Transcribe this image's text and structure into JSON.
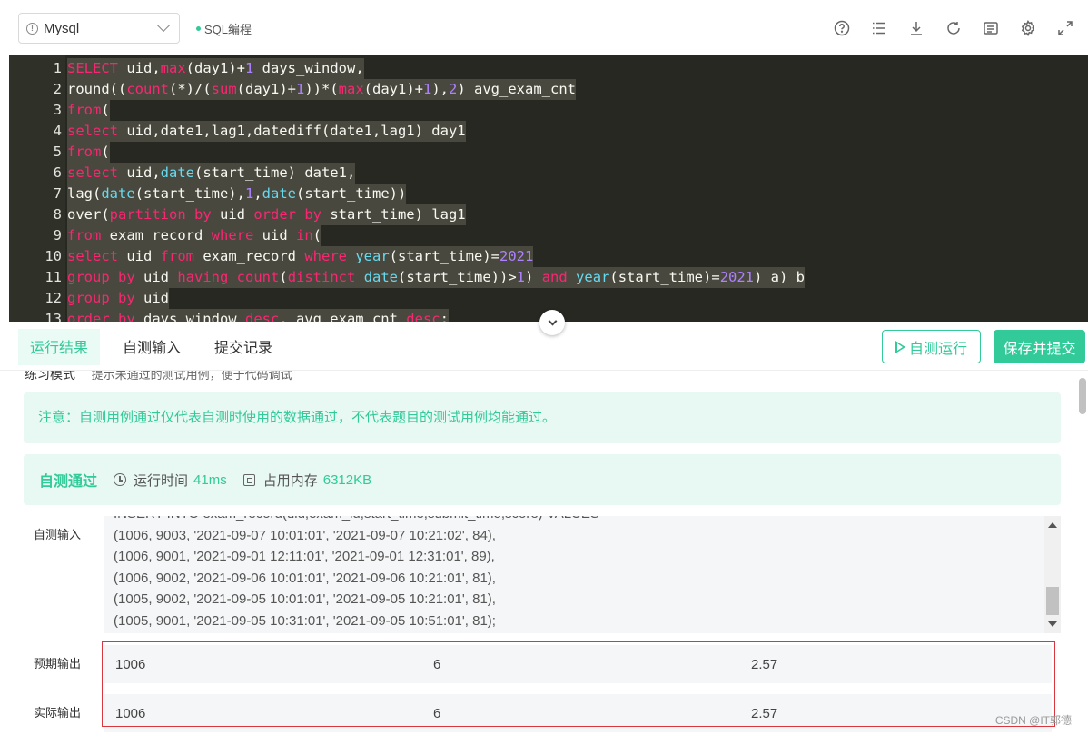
{
  "toolbar": {
    "db_select": "Mysql",
    "mode_tag": "SQL编程"
  },
  "editor": {
    "lines": [
      {
        "no": "1",
        "parts": [
          [
            "kw",
            "SELECT"
          ],
          [
            "t",
            " uid,"
          ],
          [
            "kw",
            "max"
          ],
          [
            "t",
            "(day1)+"
          ],
          [
            "num",
            "1"
          ],
          [
            "t",
            " days_window,"
          ]
        ]
      },
      {
        "no": "2",
        "parts": [
          [
            "t",
            "round(("
          ],
          [
            "kw",
            "count"
          ],
          [
            "t",
            "(*)/("
          ],
          [
            "kw",
            "sum"
          ],
          [
            "t",
            "(day1)+"
          ],
          [
            "num",
            "1"
          ],
          [
            "t",
            "))*("
          ],
          [
            "kw",
            "max"
          ],
          [
            "t",
            "(day1)+"
          ],
          [
            "num",
            "1"
          ],
          [
            "t",
            "),"
          ],
          [
            "num",
            "2"
          ],
          [
            "t",
            ") avg_exam_cnt"
          ]
        ]
      },
      {
        "no": "3",
        "parts": [
          [
            "kw",
            "from"
          ],
          [
            "t",
            "("
          ]
        ]
      },
      {
        "no": "4",
        "parts": [
          [
            "kw",
            "select"
          ],
          [
            "t",
            " uid,date1,lag1,datediff(date1,lag1) day1"
          ]
        ]
      },
      {
        "no": "5",
        "parts": [
          [
            "kw",
            "from"
          ],
          [
            "t",
            "("
          ]
        ]
      },
      {
        "no": "6",
        "parts": [
          [
            "kw",
            "select"
          ],
          [
            "t",
            " uid,"
          ],
          [
            "fn",
            "date"
          ],
          [
            "t",
            "(start_time) date1,"
          ]
        ]
      },
      {
        "no": "7",
        "parts": [
          [
            "t",
            "lag("
          ],
          [
            "fn",
            "date"
          ],
          [
            "t",
            "(start_time),"
          ],
          [
            "num",
            "1"
          ],
          [
            "t",
            ","
          ],
          [
            "fn",
            "date"
          ],
          [
            "t",
            "(start_time))"
          ]
        ]
      },
      {
        "no": "8",
        "parts": [
          [
            "t",
            "over("
          ],
          [
            "kw",
            "partition by"
          ],
          [
            "t",
            " uid "
          ],
          [
            "kw",
            "order by"
          ],
          [
            "t",
            " start_time) lag1"
          ]
        ]
      },
      {
        "no": "9",
        "parts": [
          [
            "kw",
            "from"
          ],
          [
            "t",
            " exam_record "
          ],
          [
            "kw",
            "where"
          ],
          [
            "t",
            " uid "
          ],
          [
            "kw",
            "in"
          ],
          [
            "t",
            "("
          ]
        ]
      },
      {
        "no": "10",
        "parts": [
          [
            "kw",
            "select"
          ],
          [
            "t",
            " uid "
          ],
          [
            "kw",
            "from"
          ],
          [
            "t",
            " exam_record "
          ],
          [
            "kw",
            "where"
          ],
          [
            "t",
            " "
          ],
          [
            "fn",
            "year"
          ],
          [
            "t",
            "(start_time)="
          ],
          [
            "num",
            "2021"
          ]
        ]
      },
      {
        "no": "11",
        "parts": [
          [
            "kw",
            "group by"
          ],
          [
            "t",
            " uid "
          ],
          [
            "kw",
            "having"
          ],
          [
            "t",
            " "
          ],
          [
            "kw",
            "count"
          ],
          [
            "t",
            "("
          ],
          [
            "kw",
            "distinct"
          ],
          [
            "t",
            " "
          ],
          [
            "fn",
            "date"
          ],
          [
            "t",
            "(start_time))>"
          ],
          [
            "num",
            "1"
          ],
          [
            "t",
            ") "
          ],
          [
            "kw",
            "and"
          ],
          [
            "t",
            " "
          ],
          [
            "fn",
            "year"
          ],
          [
            "t",
            "(start_time)="
          ],
          [
            "num",
            "2021"
          ],
          [
            "t",
            ") a) b"
          ]
        ]
      },
      {
        "no": "12",
        "parts": [
          [
            "kw",
            "group by"
          ],
          [
            "t",
            " uid"
          ]
        ]
      },
      {
        "no": "13",
        "parts": [
          [
            "kw",
            "order by"
          ],
          [
            "t",
            " days_window "
          ],
          [
            "kw",
            "desc"
          ],
          [
            "t",
            ", avg_exam_cnt "
          ],
          [
            "kw",
            "desc"
          ],
          [
            "t",
            ";"
          ]
        ]
      }
    ]
  },
  "tabs": {
    "result": "运行结果",
    "custom_input": "自测输入",
    "history": "提交记录",
    "run_btn": "自测运行",
    "save_btn": "保存并提交"
  },
  "panel": {
    "practice_mode": "练习模式",
    "practice_hint": "提示未通过的测试用例，便于代码调试",
    "notice": "注意：自测用例通过仅代表自测时使用的数据通过，不代表题目的测试用例均能通过。",
    "pass": "自测通过",
    "run_time_label": "运行时间",
    "run_time": "41ms",
    "memory_label": "占用内存",
    "memory": "6312KB",
    "input_label": "自测输入",
    "input_lines": [
      "INSERT INTO exam_record(uid,exam_id,start_time,submit_time,score) VALUES",
      "(1006, 9003, '2021-09-07 10:01:01', '2021-09-07 10:21:02', 84),",
      "(1006, 9001, '2021-09-01 12:11:01', '2021-09-01 12:31:01', 89),",
      "(1006, 9002, '2021-09-06 10:01:01', '2021-09-06 10:21:01', 81),",
      "(1005, 9002, '2021-09-05 10:01:01', '2021-09-05 10:21:01', 81),",
      "(1005, 9001, '2021-09-05 10:31:01', '2021-09-05 10:51:01', 81);"
    ],
    "expected_label": "预期输出",
    "expected": [
      "1006",
      "6",
      "2.57"
    ],
    "actual_label": "实际输出",
    "actual": [
      "1006",
      "6",
      "2.57"
    ]
  },
  "watermark": "CSDN @IT郭德"
}
